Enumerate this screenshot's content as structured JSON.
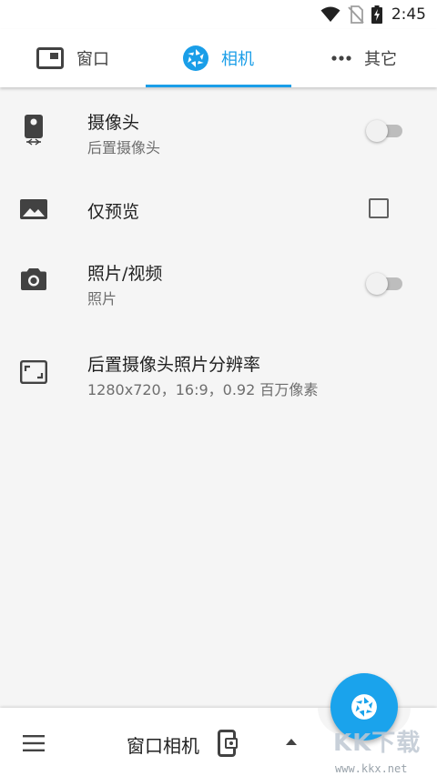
{
  "status_bar": {
    "time": "2:45",
    "icons": [
      "wifi-icon",
      "no-sim-icon",
      "battery-charging-icon"
    ]
  },
  "tabs": [
    {
      "label": "窗口",
      "icon": "window-icon",
      "active": false
    },
    {
      "label": "相机",
      "icon": "shutter-icon",
      "active": true
    },
    {
      "label": "其它",
      "icon": "more-dots-icon",
      "active": false
    }
  ],
  "accent_color": "#1a9ee8",
  "settings": [
    {
      "title": "摄像头",
      "subtitle": "后置摄像头",
      "icon": "camera-switch-icon",
      "control": "switch",
      "on": false
    },
    {
      "title": "仅预览",
      "subtitle": "",
      "icon": "image-icon",
      "control": "checkbox",
      "checked": false
    },
    {
      "title": "照片/视频",
      "subtitle": "照片",
      "icon": "camera-icon",
      "control": "switch",
      "on": false
    },
    {
      "title": "后置摄像头照片分辨率",
      "subtitle": "1280x720，16:9，0.92 百万像素",
      "icon": "aspect-ratio-icon",
      "control": "none"
    }
  ],
  "bottom_bar": {
    "title": "窗口相机",
    "menu_icon": "hamburger-menu-icon",
    "mode_icon": "phone-window-icon",
    "expand_icon": "caret-up-icon",
    "fab_icon": "shutter-icon"
  },
  "watermark": {
    "logo_text": "KK下载",
    "url": "www.kkx.net"
  }
}
